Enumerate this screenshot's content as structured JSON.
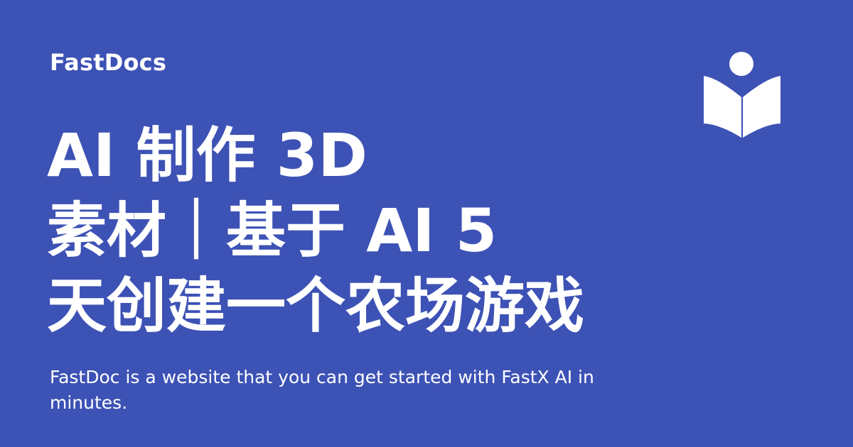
{
  "brand": {
    "name": "FastDocs",
    "icon": "open-book-reader-icon"
  },
  "headline": {
    "lines": [
      "AI 制作 3D",
      "素材｜基于 AI 5",
      "天创建一个农场游戏"
    ]
  },
  "description": "FastDoc is a website that you can get started with FastX AI in minutes.",
  "colors": {
    "background": "#3d52b5",
    "text": "#ffffff"
  }
}
